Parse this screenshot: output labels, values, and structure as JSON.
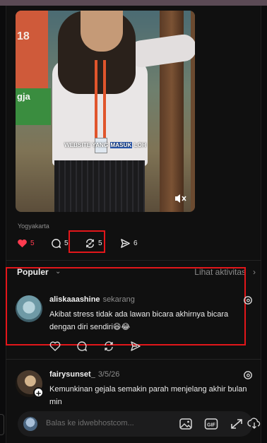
{
  "post": {
    "video_caption_part1": "WEBSITE YANG ",
    "video_caption_highlight": "MASUK",
    "video_caption_part2": " LOH",
    "sign_text_1": "18",
    "sign_text_2": "gja",
    "location": "Yogyakarta",
    "likes": "5",
    "comments": "5",
    "reposts": "5",
    "shares": "6"
  },
  "comments_header": {
    "sort_label": "Populer",
    "activity_link": "Lihat aktivitas"
  },
  "comments": [
    {
      "username": "aliskaaashine",
      "time": "sekarang",
      "text": "Akibat stress tidak ada lawan bicara akhirnya bicara dengan diri sendiri😆😂"
    },
    {
      "username": "fairysunset_",
      "time": "3/5/26",
      "text": "Kemunkinan gejala semakin parah menjelang akhir bulan min"
    }
  ],
  "reply": {
    "placeholder": "Balas ke idwebhostcom..."
  },
  "colors": {
    "highlight": "#e3161a",
    "like_red": "#ff3b4f",
    "caption_highlight": "#2c5db8"
  },
  "icons": [
    "heart-icon",
    "comment-icon",
    "repost-icon",
    "share-icon",
    "mute-icon",
    "threads-icon",
    "image-icon",
    "gif-icon",
    "expand-icon",
    "download-icon"
  ]
}
